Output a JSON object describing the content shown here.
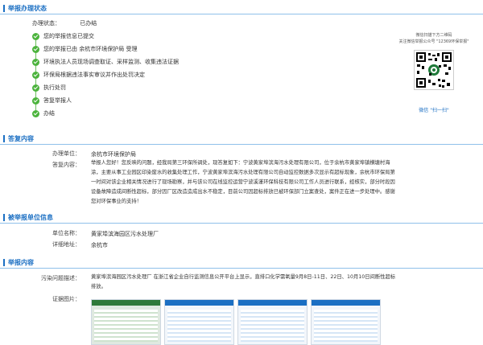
{
  "sections": {
    "status": "举报办理状态",
    "reply": "答复内容",
    "reported_unit": "被举报单位信息",
    "report_content": "举报内容"
  },
  "status": {
    "label": "办理状态：",
    "value": "已办结",
    "steps": [
      "您的举报信息已提交",
      "您的举报已由 余杭市环境保护局 受理",
      "环境执法人员现场调查取证、采样监测、收集违法证据",
      "环保局根据违法事实审议并作出处罚决定",
      "执行处罚",
      "答复举报人",
      "办结"
    ]
  },
  "qr_panel": {
    "line1": "微信扫描下方二维码",
    "line2": "关注微信举报公众号 \"12369环保举报\"",
    "caption": "微信 \"扫一扫\""
  },
  "reply": {
    "unit_label": "办理单位：",
    "unit_value": "余杭市环境保护局",
    "content_label": "答复内容：",
    "content_lines": [
      "举报人您好！您反映的问题，经我局第三环保所调处，现答复如下：宁波黄家埠滨海污水处理有限公司，位于余杭市黄家埠镇横塘村海",
      "涂，主要从事工业园区印染废水的收集处理工作，宁波黄家埠滨海污水处理有限公司自动监控数据多次显示有超标现象，余杭市环保局第",
      "一时间对该企业相关情况进行了现场勘察，并与该公司在线监控运营宁波溪谨环保科技有限公司工作人员进行联系，经核实，部分时段因",
      "设备故障造成间断性超标，部分因厂区改造造成出水不稳定，目前公司因超标排放已被环保部门立案查处，案件正在进一步处理中。感谢",
      "您对环保事业的支持！"
    ]
  },
  "reported_unit": {
    "name_label": "单位名称：",
    "name_value": "黄家埠滨海园区污水处理厂",
    "addr_label": "详细地址：",
    "addr_value": "余杭市"
  },
  "report_content": {
    "problem_label": "污染问题描述：",
    "problem_lines": [
      "黄家埠滨海园区污水处理厂 在浙江省企业自行监测信息公开平台上显示，直排口化学需氧量9月8日-11日、22日、10月10日间断性超标",
      "排放。"
    ],
    "evidence_label": "证据图片："
  },
  "colors": {
    "accent": "#1b6fc3",
    "check": "#4bb33c"
  }
}
